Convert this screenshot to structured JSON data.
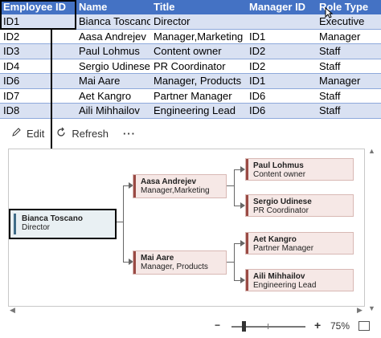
{
  "sheet": {
    "headers": [
      "Employee ID",
      "Name",
      "Title",
      "Manager ID",
      "Role Type"
    ],
    "rows": [
      [
        "ID1",
        "Bianca Toscano",
        "Director",
        "",
        "Executive"
      ],
      [
        "ID2",
        "Aasa Andrejev",
        "Manager,Marketing",
        "ID1",
        "Manager"
      ],
      [
        "ID3",
        "Paul Lohmus",
        "Content owner",
        "ID2",
        "Staff"
      ],
      [
        "ID4",
        "Sergio Udinese",
        "PR Coordinator",
        "ID2",
        "Staff"
      ],
      [
        "ID6",
        "Mai Aare",
        "Manager, Products",
        "ID1",
        "Manager"
      ],
      [
        "ID7",
        "Aet Kangro",
        "Partner Manager",
        "ID6",
        "Staff"
      ],
      [
        "ID8",
        "Aili Mihhailov",
        "Engineering Lead",
        "ID6",
        "Staff"
      ]
    ]
  },
  "toolbar": {
    "edit_label": "Edit",
    "refresh_label": "Refresh",
    "more_label": "···"
  },
  "org": {
    "root": {
      "name": "Bianca Toscano",
      "title": "Director"
    },
    "m1": {
      "name": "Aasa Andrejev",
      "title": "Manager,Marketing"
    },
    "m2": {
      "name": "Mai Aare",
      "title": "Manager, Products"
    },
    "s1": {
      "name": "Paul Lohmus",
      "title": "Content owner"
    },
    "s2": {
      "name": "Sergio Udinese",
      "title": "PR Coordinator"
    },
    "s3": {
      "name": "Aet Kangro",
      "title": "Partner Manager"
    },
    "s4": {
      "name": "Aili Mihhailov",
      "title": "Engineering Lead"
    }
  },
  "status": {
    "zoom_minus": "−",
    "zoom_plus": "+",
    "zoom_value": "75%"
  },
  "colors": {
    "header_bg": "#4472c4",
    "band_bg": "#d9e1f2",
    "manager_node": "#f6e8e6",
    "root_node": "#e9f0f3"
  },
  "icons": {
    "edit": "pencil-icon",
    "refresh": "refresh-icon",
    "cursor": "pointer-cursor-icon"
  }
}
